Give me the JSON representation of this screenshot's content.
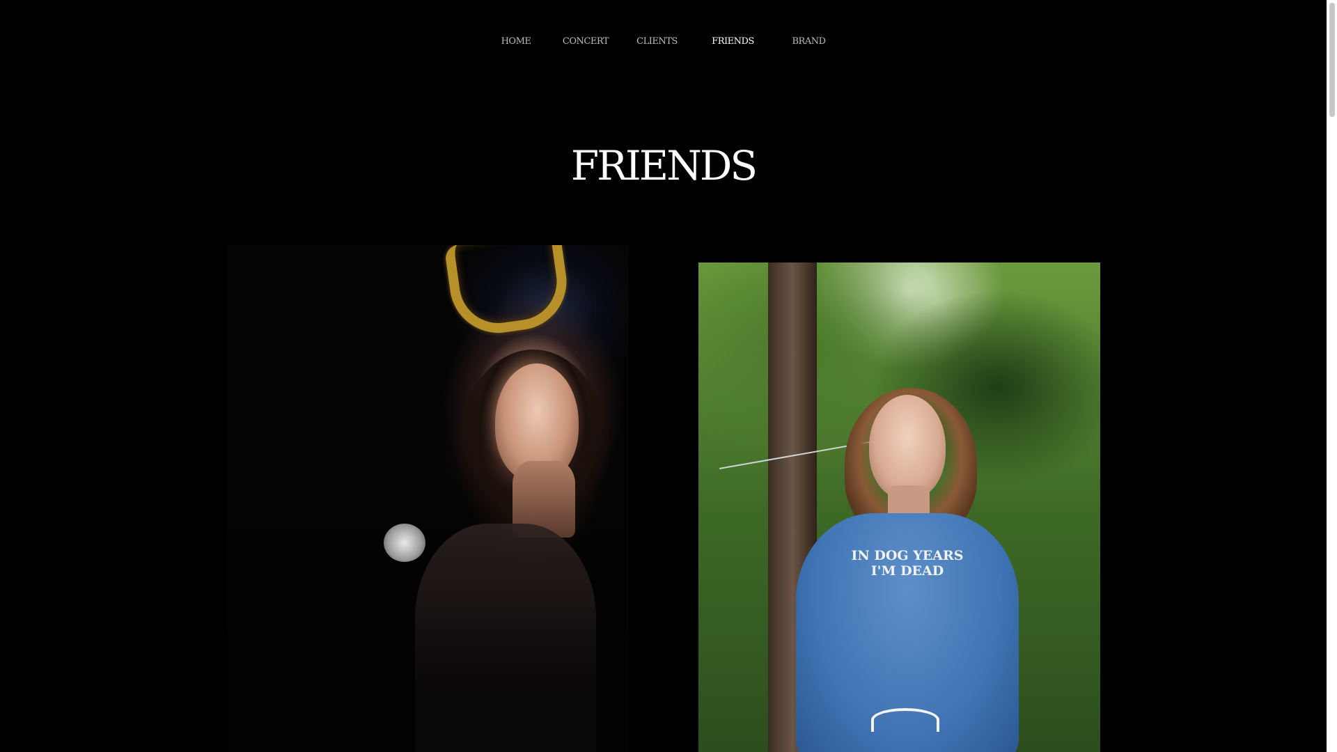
{
  "nav": {
    "items": [
      {
        "label": "HOME",
        "active": false
      },
      {
        "label": "CONCERT",
        "active": false
      },
      {
        "label": "CLIENTS",
        "active": false
      },
      {
        "label": "FRIENDS",
        "active": true
      },
      {
        "label": "BRAND",
        "active": false
      }
    ]
  },
  "page": {
    "title": "FRIENDS"
  },
  "photos": {
    "right": {
      "shirt_text_line1": "IN DOG YEARS",
      "shirt_text_line2": "I'M DEAD"
    }
  },
  "colors": {
    "background": "#000000",
    "nav_text": "#bdbdbd",
    "nav_active": "#ffffff",
    "title": "#ffffff"
  }
}
